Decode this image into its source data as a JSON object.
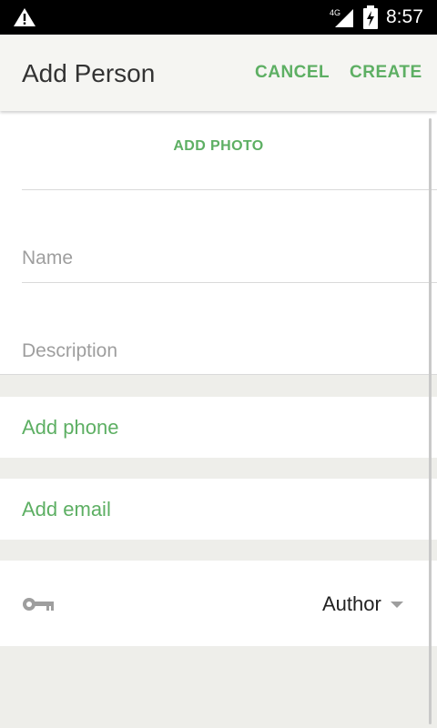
{
  "status_bar": {
    "time": "8:57",
    "network": "4G",
    "icons": [
      "alert-icon",
      "signal-icon",
      "battery-charging-icon"
    ]
  },
  "header": {
    "title": "Add Person",
    "cancel_label": "CANCEL",
    "create_label": "CREATE"
  },
  "form": {
    "add_photo_label": "ADD PHOTO",
    "name_placeholder": "Name",
    "name_value": "",
    "description_placeholder": "Description",
    "description_value": "",
    "add_phone_label": "Add phone",
    "add_email_label": "Add email",
    "role": {
      "icon": "key-icon",
      "selected": "Author"
    }
  },
  "colors": {
    "accent": "#5DAF63",
    "appbar": "#F5F5F2",
    "background": "#EEEEEA",
    "statusbar": "#000000"
  }
}
